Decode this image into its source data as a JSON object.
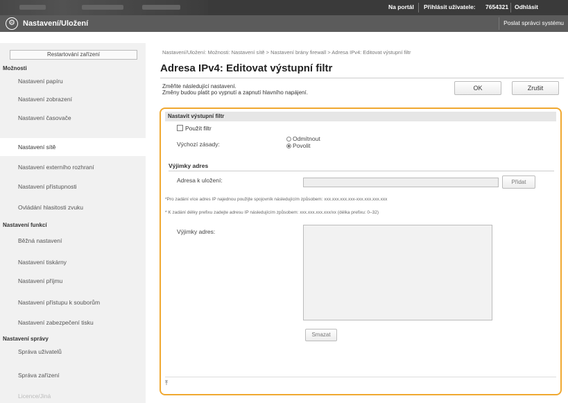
{
  "topbar": {
    "portal_link": "Na portál",
    "user_label": "Přihlásit uživatele:",
    "user_id": "7654321",
    "logout": "Odhlásit"
  },
  "header": {
    "title": "Nastavení/Uložení",
    "admin_mail": "Poslat správci systému"
  },
  "sidebar": {
    "restart": "Restartování zařízení",
    "sections": {
      "options": "Možnosti",
      "function_settings": "Nastavení funkcí",
      "management_settings": "Nastavení správy"
    },
    "items_options": [
      "Nastavení papíru",
      "Nastavení zobrazení",
      "Nastavení časovače",
      "Nastavení sítě",
      "Nastavení externího rozhraní",
      "Nastavení přístupnosti",
      "Ovládání hlasitosti zvuku"
    ],
    "items_functions": [
      "Běžná nastavení",
      "Nastavení tiskárny",
      "Nastavení příjmu",
      "Nastavení přístupu k souborům",
      "Nastavení zabezpečení tisku"
    ],
    "items_management": [
      "Správa uživatelů",
      "Správa zařízení",
      "Licence/Jiná"
    ]
  },
  "main": {
    "breadcrumb": "Nastavení/Uložení: Možnosti: Nastavení sítě > Nastavení brány firewall > Adresa IPv4: Editovat výstupní filtr",
    "title": "Adresa IPv4: Editovat výstupní filtr",
    "note_line1": "Změňte následující nastavení.",
    "note_line2": "Změny budou platit po vypnutí a zapnutí hlavního napájení.",
    "ok": "OK",
    "cancel": "Zrušit",
    "panel": {
      "heading": "Nastavit výstupní filtr",
      "use_filter": "Použít filtr",
      "default_policy_label": "Výchozí zásady:",
      "policy_reject": "Odmítnout",
      "policy_allow": "Povolit",
      "policy_selected": "Povolit",
      "exceptions_heading": "Výjimky adres",
      "address_to_save_label": "Adresa k uložení:",
      "add_button": "Přidat",
      "hint1": "*Pro zadání více adres IP najednou použijte spojovník následujícím způsobem: xxx.xxx.xxx.xxx-xxx.xxx.xxx.xxx",
      "hint2": "* K zadání délky prefixu zadejte adresu IP následujícím způsobem: xxx.xxx.xxx.xxx/xx (délka prefixu: 0–32)",
      "exceptions_list_label": "Výjimky adres:",
      "delete_button": "Smazat"
    }
  }
}
